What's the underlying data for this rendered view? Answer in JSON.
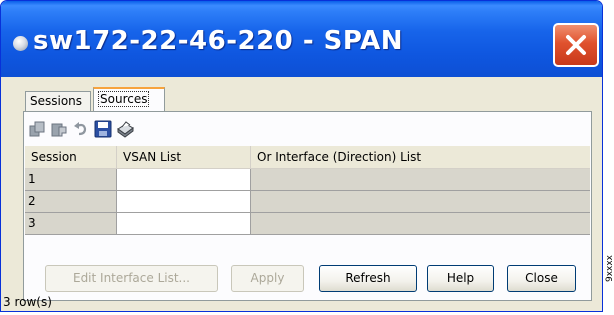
{
  "window": {
    "title": "sw172-22-46-220 - SPAN"
  },
  "tabs": [
    {
      "label": "Sessions",
      "active": false
    },
    {
      "label": "Sources",
      "active": true
    }
  ],
  "toolbar": {
    "icons": [
      "copy-rows-icon",
      "paste-rows-icon",
      "undo-icon",
      "save-icon",
      "print-icon"
    ]
  },
  "table": {
    "columns": [
      "Session",
      "VSAN List",
      "Or Interface (Direction) List"
    ],
    "rows": [
      {
        "session": "1",
        "vsan_list": "",
        "interface_list": ""
      },
      {
        "session": "2",
        "vsan_list": "",
        "interface_list": ""
      },
      {
        "session": "3",
        "vsan_list": "",
        "interface_list": ""
      }
    ]
  },
  "buttons": {
    "edit_interface_list": "Edit Interface List...",
    "apply": "Apply",
    "refresh": "Refresh",
    "help": "Help",
    "close": "Close"
  },
  "status": {
    "row_count": "3 row(s)"
  },
  "side_label": "9xxxx"
}
